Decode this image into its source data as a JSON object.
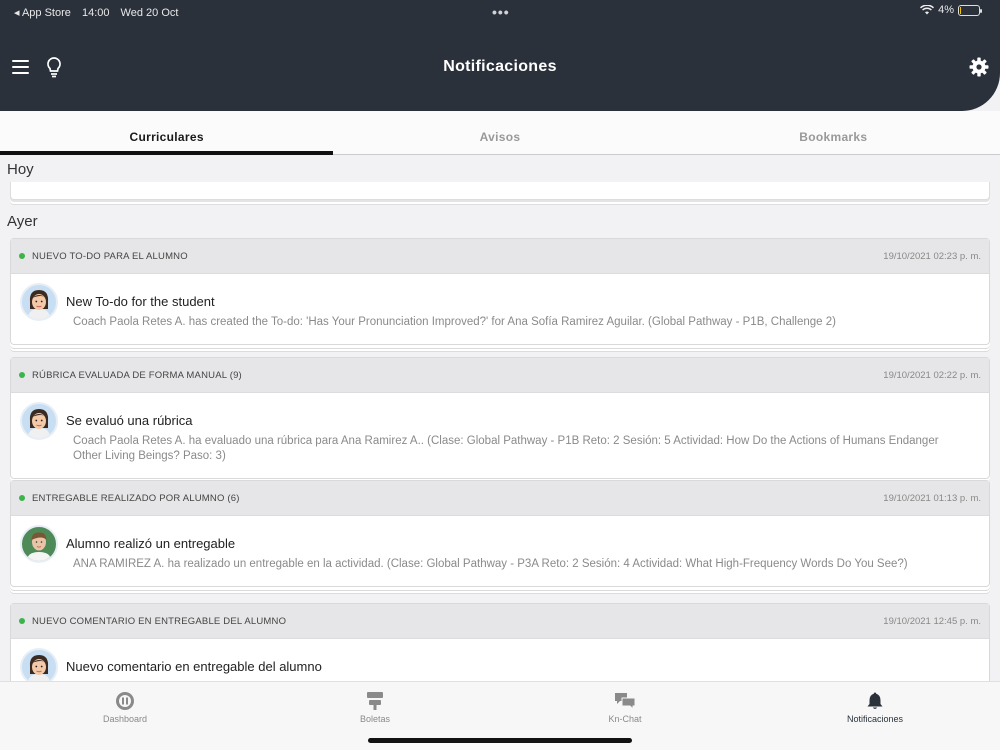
{
  "status_bar": {
    "back_label": "◂ App Store",
    "time": "14:00",
    "date": "Wed 20 Oct",
    "battery": "4%",
    "more_dots": "•••"
  },
  "header": {
    "title": "Notificaciones",
    "icons": [
      "menu-icon",
      "lightbulb-icon",
      "gear-icon"
    ]
  },
  "tabs": [
    {
      "label": "Curriculares",
      "active": true
    },
    {
      "label": "Avisos",
      "active": false
    },
    {
      "label": "Bookmarks",
      "active": false
    }
  ],
  "sections": {
    "today": "Hoy",
    "yesterday": "Ayer"
  },
  "notifications": [
    {
      "category": "NUEVO TO-DO PARA EL ALUMNO",
      "date": "19/10/2021 02:23 p. m.",
      "title": "New To-do for the student",
      "description": "Coach Paola Retes A. has created the To-do: 'Has Your Pronunciation Improved?' for Ana Sofía Ramirez Aguilar. (Global Pathway - P1B, Challenge 2)"
    },
    {
      "category": "RÚBRICA EVALUADA DE FORMA MANUAL (9)",
      "date": "19/10/2021 02:22 p. m.",
      "title": "Se evaluó una rúbrica",
      "description": "Coach Paola Retes A. ha evaluado una rúbrica para Ana Ramirez A.. (Clase: Global Pathway - P1B Reto: 2 Sesión: 5 Actividad: How Do the Actions of Humans Endanger Other Living Beings? Paso: 3)"
    },
    {
      "category": "ENTREGABLE REALIZADO POR ALUMNO (6)",
      "date": "19/10/2021 01:13 p. m.",
      "title": "Alumno realizó un entregable",
      "description": "ANA RAMIREZ A. ha realizado un entregable en la actividad. (Clase: Global Pathway - P3A Reto: 2 Sesión: 4 Actividad: What High-Frequency Words Do You See?)"
    },
    {
      "category": "NUEVO COMENTARIO EN ENTREGABLE DEL ALUMNO",
      "date": "19/10/2021 12:45 p. m.",
      "title": "Nuevo comentario en entregable del alumno",
      "description": ""
    }
  ],
  "bottom_nav": [
    {
      "label": "Dashboard",
      "icon": "dashboard-icon",
      "active": false
    },
    {
      "label": "Boletas",
      "icon": "report-card-icon",
      "active": false
    },
    {
      "label": "Kn-Chat",
      "icon": "chat-icon",
      "active": false
    },
    {
      "label": "Notificaciones",
      "icon": "bell-icon",
      "active": true
    }
  ],
  "colors": {
    "header_bg": "#2a313b",
    "status_dot": "#3cb44a",
    "active_tab_underline": "#111111"
  }
}
